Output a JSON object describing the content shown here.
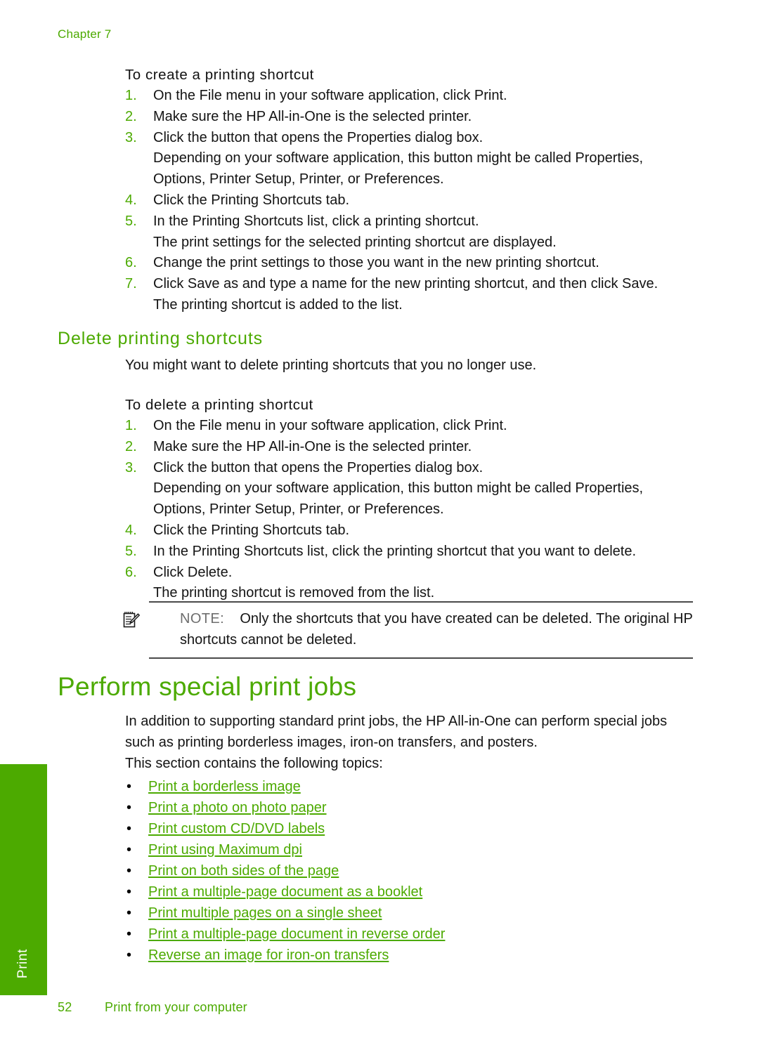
{
  "header": {
    "chapter": "Chapter 7"
  },
  "section_create": {
    "procedure_title": "To create a printing shortcut",
    "steps": [
      {
        "num": "1.",
        "text": "On the File menu in your software application, click Print."
      },
      {
        "num": "2.",
        "text": "Make sure the HP All-in-One is the selected printer."
      },
      {
        "num": "3.",
        "text": "Click the button that opens the Properties dialog box.",
        "sub": "Depending on your software application, this button might be called Properties, Options, Printer Setup, Printer, or Preferences."
      },
      {
        "num": "4.",
        "text": "Click the Printing Shortcuts tab."
      },
      {
        "num": "5.",
        "text": "In the Printing Shortcuts list, click a printing shortcut.",
        "sub": "The print settings for the selected printing shortcut are displayed."
      },
      {
        "num": "6.",
        "text": "Change the print settings to those you want in the new printing shortcut."
      },
      {
        "num": "7.",
        "text": "Click Save as and type a name for the new printing shortcut, and then click Save.",
        "sub": "The printing shortcut is added to the list."
      }
    ]
  },
  "section_delete": {
    "heading": "Delete printing shortcuts",
    "intro": "You might want to delete printing shortcuts that you no longer use.",
    "procedure_title": "To delete a printing shortcut",
    "steps": [
      {
        "num": "1.",
        "text": "On the File menu in your software application, click Print."
      },
      {
        "num": "2.",
        "text": "Make sure the HP All-in-One is the selected printer."
      },
      {
        "num": "3.",
        "text": "Click the button that opens the Properties dialog box.",
        "sub": "Depending on your software application, this button might be called Properties, Options, Printer Setup, Printer, or Preferences."
      },
      {
        "num": "4.",
        "text": "Click the Printing Shortcuts tab."
      },
      {
        "num": "5.",
        "text": "In the Printing Shortcuts list, click the printing shortcut that you want to delete."
      },
      {
        "num": "6.",
        "text": "Click Delete.",
        "sub": "The printing shortcut is removed from the list."
      }
    ],
    "note": {
      "label": "NOTE:",
      "text": "Only the shortcuts that you have created can be deleted. The original HP shortcuts cannot be deleted."
    }
  },
  "section_special": {
    "heading": "Perform special print jobs",
    "intro": "In addition to supporting standard print jobs, the HP All-in-One can perform special jobs such as printing borderless images, iron-on transfers, and posters.",
    "topics_intro": "This section contains the following topics:",
    "bullet": "•",
    "topics": [
      "Print a borderless image",
      "Print a photo on photo paper",
      "Print custom CD/DVD labels",
      "Print using Maximum dpi",
      "Print on both sides of the page",
      "Print a multiple-page document as a booklet",
      "Print multiple pages on a single sheet",
      "Print a multiple-page document in reverse order",
      "Reverse an image for iron-on transfers"
    ]
  },
  "side_tab": {
    "label": "Print"
  },
  "footer": {
    "page_number": "52",
    "section_title": "Print from your computer"
  },
  "colors": {
    "brand_green": "#4CAA00",
    "body_text": "#141414",
    "note_label": "#6e6e6e",
    "rule": "#4a4a4a"
  }
}
